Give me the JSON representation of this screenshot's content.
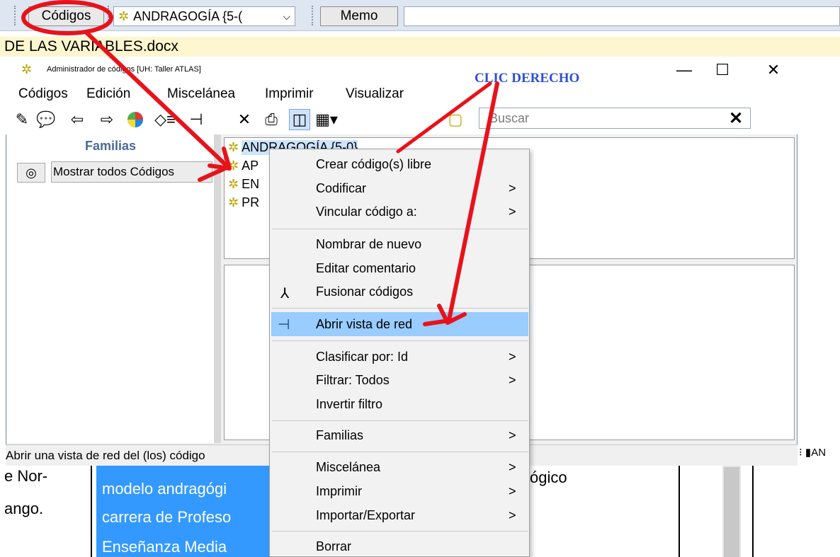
{
  "toolbar": {
    "codigos_label": "Códigos",
    "code_combo_value": "ANDRAGOGÍA {5-(",
    "memo_label": "Memo"
  },
  "document": {
    "title": "DE LAS VARIABLES.docx",
    "left_col": [
      "e Nor-",
      "ango."
    ],
    "highlight_lines": [
      "modelo andragógi",
      "carrera de Profeso",
      "Enseñanza Media"
    ],
    "right_fragment": "ógico"
  },
  "window": {
    "title": "Administrador de códigos [UH: Taller ATLAS]",
    "menu": [
      "Códigos",
      "Edición",
      "Miscelánea",
      "Imprimir",
      "Visualizar"
    ],
    "search_placeholder": "Buscar",
    "familias_header": "Familias",
    "show_all_label": "Mostrar todos Códigos",
    "codes": [
      "ANDRAGOGÍA {5-0}",
      "AP",
      "EN",
      "PR"
    ],
    "status": "Abrir una vista de red del (los) código",
    "status_right": "⁝ ▮AN"
  },
  "context_menu": {
    "items": [
      {
        "label": "Crear código(s) libre",
        "arrow": ""
      },
      {
        "label": "Codificar",
        "arrow": ">"
      },
      {
        "label": "Vincular código a:",
        "arrow": ">"
      },
      {
        "label": "Nombrar de nuevo",
        "arrow": ""
      },
      {
        "label": "Editar comentario",
        "arrow": ""
      },
      {
        "label": "Fusionar códigos",
        "arrow": ""
      },
      {
        "label": "Abrir vista de red",
        "arrow": ""
      },
      {
        "label": "Clasificar por: Id",
        "arrow": ">"
      },
      {
        "label": "Filtrar: Todos",
        "arrow": ">"
      },
      {
        "label": "Invertir filtro",
        "arrow": ""
      },
      {
        "label": "Familias",
        "arrow": ">"
      },
      {
        "label": "Miscelánea",
        "arrow": ">"
      },
      {
        "label": "Imprimir",
        "arrow": ">"
      },
      {
        "label": "Importar/Exportar",
        "arrow": ">"
      },
      {
        "label": "Borrar",
        "arrow": ""
      }
    ]
  },
  "annotation": {
    "label": "CLIC DERECHO",
    "color": "#e8121b"
  },
  "colors": {
    "highlight": "#3399ff",
    "menu_hover": "#99ccff",
    "titlebar": "#dde6f1"
  }
}
